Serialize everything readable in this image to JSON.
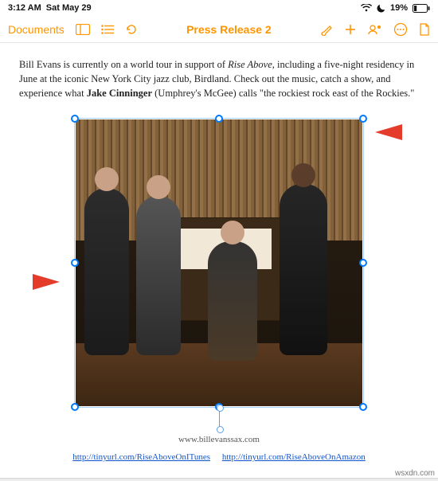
{
  "status_bar": {
    "time": "3:12 AM",
    "date": "Sat May 29",
    "battery_pct": "19%"
  },
  "toolbar": {
    "back_label": "Documents",
    "title": "Press Release 2"
  },
  "document": {
    "body_pre": "Bill Evans is currently on a world tour in support of ",
    "body_italic": "Rise Above",
    "body_mid": ", including a five-night residency in June at the iconic New York City jazz club, Birdland.  Check out the music, catch a show, and experience what ",
    "body_bold": "Jake Cinninger",
    "body_post": " (Umphrey's McGee) calls \"the rockiest rock east of the Rockies.\"",
    "caption": "www.billevanssax.com",
    "link1": "http://tinyurl.com/RiseAboveOnITunes",
    "link2": "http://tinyurl.com/RiseAboveOnAmazon"
  },
  "watermark": "wsxdn.com"
}
